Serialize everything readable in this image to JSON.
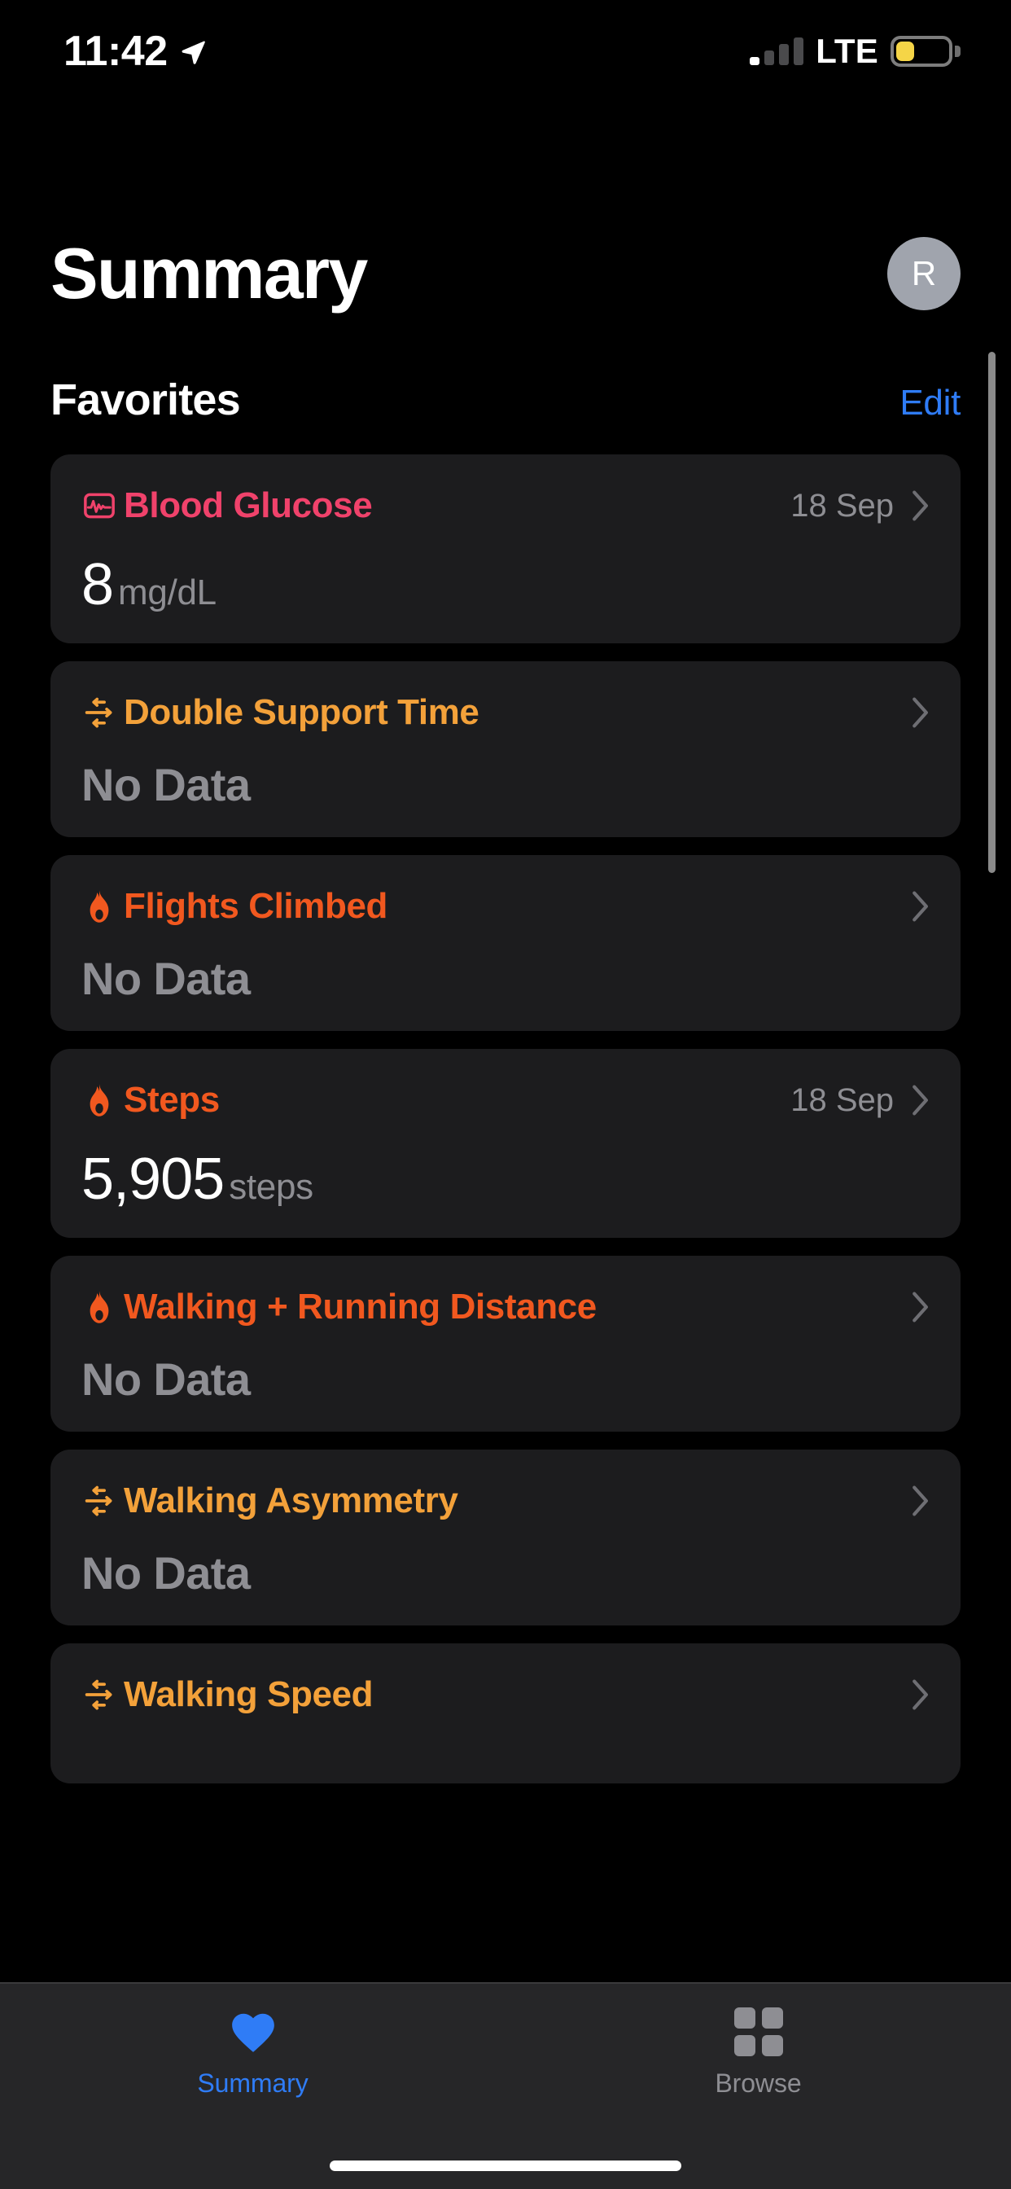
{
  "status_bar": {
    "time": "11:42",
    "location_icon": "location-arrow-icon",
    "carrier": "LTE",
    "signal_bars_filled": 1,
    "signal_bars_total": 4,
    "battery_percent": 35,
    "battery_color": "#F5D547",
    "low_power_mode": true
  },
  "header": {
    "title": "Summary",
    "avatar_initial": "R"
  },
  "section": {
    "title": "Favorites",
    "edit_label": "Edit",
    "edit_color": "#2F7CF6"
  },
  "favorites": [
    {
      "title": "Blood Glucose",
      "icon": "ecg-waveform-icon",
      "color": "#F0426B",
      "date": "18 Sep",
      "value": "8",
      "unit": "mg/dL",
      "has_data": true
    },
    {
      "title": "Double Support Time",
      "icon": "mobility-arrows-icon",
      "color": "#F3A13A",
      "date": "",
      "value": "No Data",
      "unit": "",
      "has_data": false
    },
    {
      "title": "Flights Climbed",
      "icon": "flame-icon",
      "color": "#F1581F",
      "date": "",
      "value": "No Data",
      "unit": "",
      "has_data": false
    },
    {
      "title": "Steps",
      "icon": "flame-icon",
      "color": "#F1581F",
      "date": "18 Sep",
      "value": "5,905",
      "unit": "steps",
      "has_data": true
    },
    {
      "title": "Walking + Running Distance",
      "icon": "flame-icon",
      "color": "#F1581F",
      "date": "",
      "value": "No Data",
      "unit": "",
      "has_data": false
    },
    {
      "title": "Walking Asymmetry",
      "icon": "mobility-arrows-icon",
      "color": "#F3A13A",
      "date": "",
      "value": "No Data",
      "unit": "",
      "has_data": false
    },
    {
      "title": "Walking Speed",
      "icon": "mobility-arrows-icon",
      "color": "#F3A13A",
      "date": "",
      "value": "",
      "unit": "",
      "has_data": false
    }
  ],
  "tab_bar": {
    "tabs": [
      {
        "label": "Summary",
        "icon": "heart-icon",
        "active": true,
        "color": "#2F7CF6"
      },
      {
        "label": "Browse",
        "icon": "grid-squares-icon",
        "active": false,
        "color": "#8E8E93"
      }
    ]
  }
}
